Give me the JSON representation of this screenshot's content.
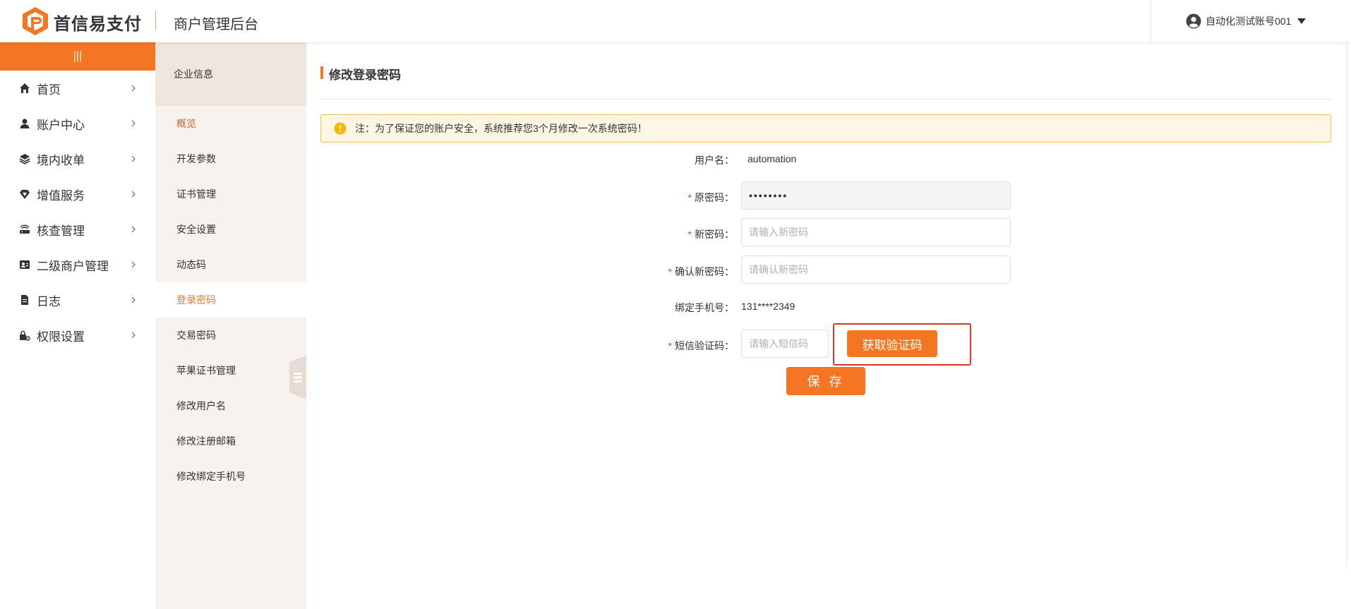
{
  "header": {
    "brand": "首信易支付",
    "subtitle": "商户管理后台",
    "user_name": "自动化测试账号001"
  },
  "leftnav": {
    "collapse_label": "|||",
    "items": [
      {
        "label": "首页",
        "icon": "home-icon"
      },
      {
        "label": "账户中心",
        "icon": "user-icon"
      },
      {
        "label": "境内收单",
        "icon": "layers-icon"
      },
      {
        "label": "增值服务",
        "icon": "diamond-icon"
      },
      {
        "label": "核查管理",
        "icon": "router-icon"
      },
      {
        "label": "二级商户管理",
        "icon": "id-card-icon"
      },
      {
        "label": "日志",
        "icon": "document-icon"
      },
      {
        "label": "权限设置",
        "icon": "lock-gear-icon"
      }
    ]
  },
  "subnav": {
    "title": "企业信息",
    "items": [
      {
        "label": "概览"
      },
      {
        "label": "开发参数"
      },
      {
        "label": "证书管理"
      },
      {
        "label": "安全设置"
      },
      {
        "label": "动态码"
      },
      {
        "label": "登录密码"
      },
      {
        "label": "交易密码"
      },
      {
        "label": "苹果证书管理"
      },
      {
        "label": "修改用户名"
      },
      {
        "label": "修改注册邮箱"
      },
      {
        "label": "修改绑定手机号"
      }
    ]
  },
  "main": {
    "title": "修改登录密码",
    "alert": "注：为了保证您的账户安全，系统推荐您3个月修改一次系统密码！",
    "form": {
      "username_label": "用户名：",
      "username_value": "automation",
      "required_mark": "*",
      "old_password_label": "原密码：",
      "old_password_value": "••••••••",
      "new_password_label": "新密码：",
      "new_password_placeholder": "请输入新密码",
      "confirm_password_label": "确认新密码：",
      "confirm_password_placeholder": "请确认新密码",
      "phone_label": "绑定手机号：",
      "phone_value": "131****2349",
      "sms_label": "短信验证码：",
      "sms_placeholder": "请输入短信码",
      "get_code_button": "获取验证码",
      "save_button": "保 存"
    }
  },
  "colors": {
    "accent": "#f47622",
    "highlight": "#d9362b",
    "alert_bg": "#fdf6e4",
    "alert_border": "#f0c64a"
  }
}
